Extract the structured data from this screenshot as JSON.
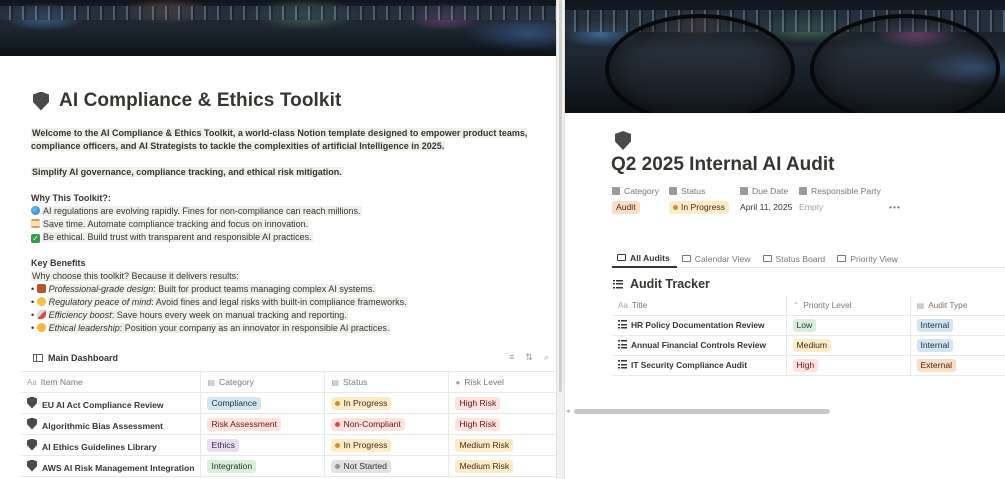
{
  "left": {
    "title": "AI Compliance & Ethics Toolkit",
    "intro": "Welcome to the AI Compliance & Ethics Toolkit, a world-class Notion template designed to empower product teams, compliance officers, and AI Strategists to tackle the complexities of artificial Intelligence in 2025.",
    "tagline": "Simplify AI governance, compliance tracking, and ethical risk mitigation.",
    "why_heading": "Why This Toolkit?:",
    "why_items": [
      {
        "icon": "globe-icon",
        "text": "AI regulations are evolving rapidly. Fines for non-compliance can reach millions."
      },
      {
        "icon": "hourglass-icon",
        "text": "Save time. Automate compliance tracking and focus on innovation."
      },
      {
        "icon": "checkmark-icon",
        "text": "Be ethical. Build trust with transparent and responsible AI practices."
      }
    ],
    "benefits_heading": "Key Benefits",
    "benefits_intro": "Why choose this toolkit? Because it delivers results:",
    "benefits": [
      {
        "icon": "briefcase-icon",
        "term": "Professional-grade design",
        "text": ": Built for product teams managing complex AI systems."
      },
      {
        "icon": "smile-icon",
        "term": "Regulatory peace of mind",
        "text": ": Avoid fines and legal risks with built-in compliance frameworks."
      },
      {
        "icon": "rocket-icon",
        "term": "Efficiency boost",
        "text": ": Save hours every week on manual tracking and reporting."
      },
      {
        "icon": "star-icon",
        "term": "Ethical leadership",
        "text": ": Position your company as an innovator in responsible AI practices."
      }
    ],
    "dashboard": {
      "label": "Main Dashboard",
      "columns": [
        "Item Name",
        "Category",
        "Status",
        "Risk Level"
      ],
      "column_icons": [
        "Aa",
        "▤",
        "▤",
        "●"
      ],
      "rows": [
        {
          "name": "EU AI Act Compliance Review",
          "category": "Compliance",
          "status": "In Progress",
          "risk": "High Risk"
        },
        {
          "name": "Algorithmic Bias Assessment",
          "category": "Risk Assessment",
          "status": "Non-Compliant",
          "risk": "High Risk"
        },
        {
          "name": "AI Ethics Guidelines Library",
          "category": "Ethics",
          "status": "In Progress",
          "risk": "Medium Risk"
        },
        {
          "name": "AWS AI Risk Management Integration",
          "category": "Integration",
          "status": "Not Started",
          "risk": "Medium Risk"
        }
      ]
    }
  },
  "right": {
    "title": "Q2 2025 Internal AI Audit",
    "properties": {
      "labels": [
        "Category",
        "Status",
        "Due Date",
        "Responsible Party"
      ],
      "category": "Audit",
      "status": "In Progress",
      "due_date": "April 11, 2025",
      "responsible": "Empty",
      "more": "•••"
    },
    "tabs": [
      "All Audits",
      "Calendar View",
      "Status Board",
      "Priority View"
    ],
    "tracker": {
      "title": "Audit Tracker",
      "columns": [
        "Title",
        "Priority Level",
        "Audit Type"
      ],
      "column_icons": [
        "Aa",
        "⌃",
        "▤"
      ],
      "rows": [
        {
          "title": "HR Policy Documentation Review",
          "priority": "Low",
          "type": "Internal"
        },
        {
          "title": "Annual Financial Controls Review",
          "priority": "Medium",
          "type": "Internal"
        },
        {
          "title": "IT Security Compliance Audit",
          "priority": "High",
          "type": "External"
        }
      ]
    }
  },
  "tag_colors": {
    "Compliance": {
      "bg": "#d3e5ef",
      "fg": "#183347"
    },
    "Risk Assessment": {
      "bg": "#ffe2dd",
      "fg": "#5d1715"
    },
    "Ethics": {
      "bg": "#e8deee",
      "fg": "#412454"
    },
    "Integration": {
      "bg": "#dbeddb",
      "fg": "#1c3829"
    },
    "In Progress": {
      "bg": "#fdecc8",
      "fg": "#402c1b",
      "dot": "#cb912f"
    },
    "Non-Compliant": {
      "bg": "#ffe2dd",
      "fg": "#5d1715",
      "dot": "#d44c47"
    },
    "Not Started": {
      "bg": "#e3e2e0",
      "fg": "#32302c",
      "dot": "#91918e"
    },
    "High Risk": {
      "bg": "#ffe2dd",
      "fg": "#5d1715"
    },
    "Medium Risk": {
      "bg": "#fdecc8",
      "fg": "#402c1b"
    },
    "Audit": {
      "bg": "#fadec9",
      "fg": "#49290e"
    },
    "Low": {
      "bg": "#dbeddb",
      "fg": "#1c3829"
    },
    "Medium": {
      "bg": "#fdecc8",
      "fg": "#402c1b"
    },
    "High": {
      "bg": "#ffe2dd",
      "fg": "#5d1715"
    },
    "Internal": {
      "bg": "#d3e5ef",
      "fg": "#183347"
    },
    "External": {
      "bg": "#fadec9",
      "fg": "#49290e"
    }
  }
}
